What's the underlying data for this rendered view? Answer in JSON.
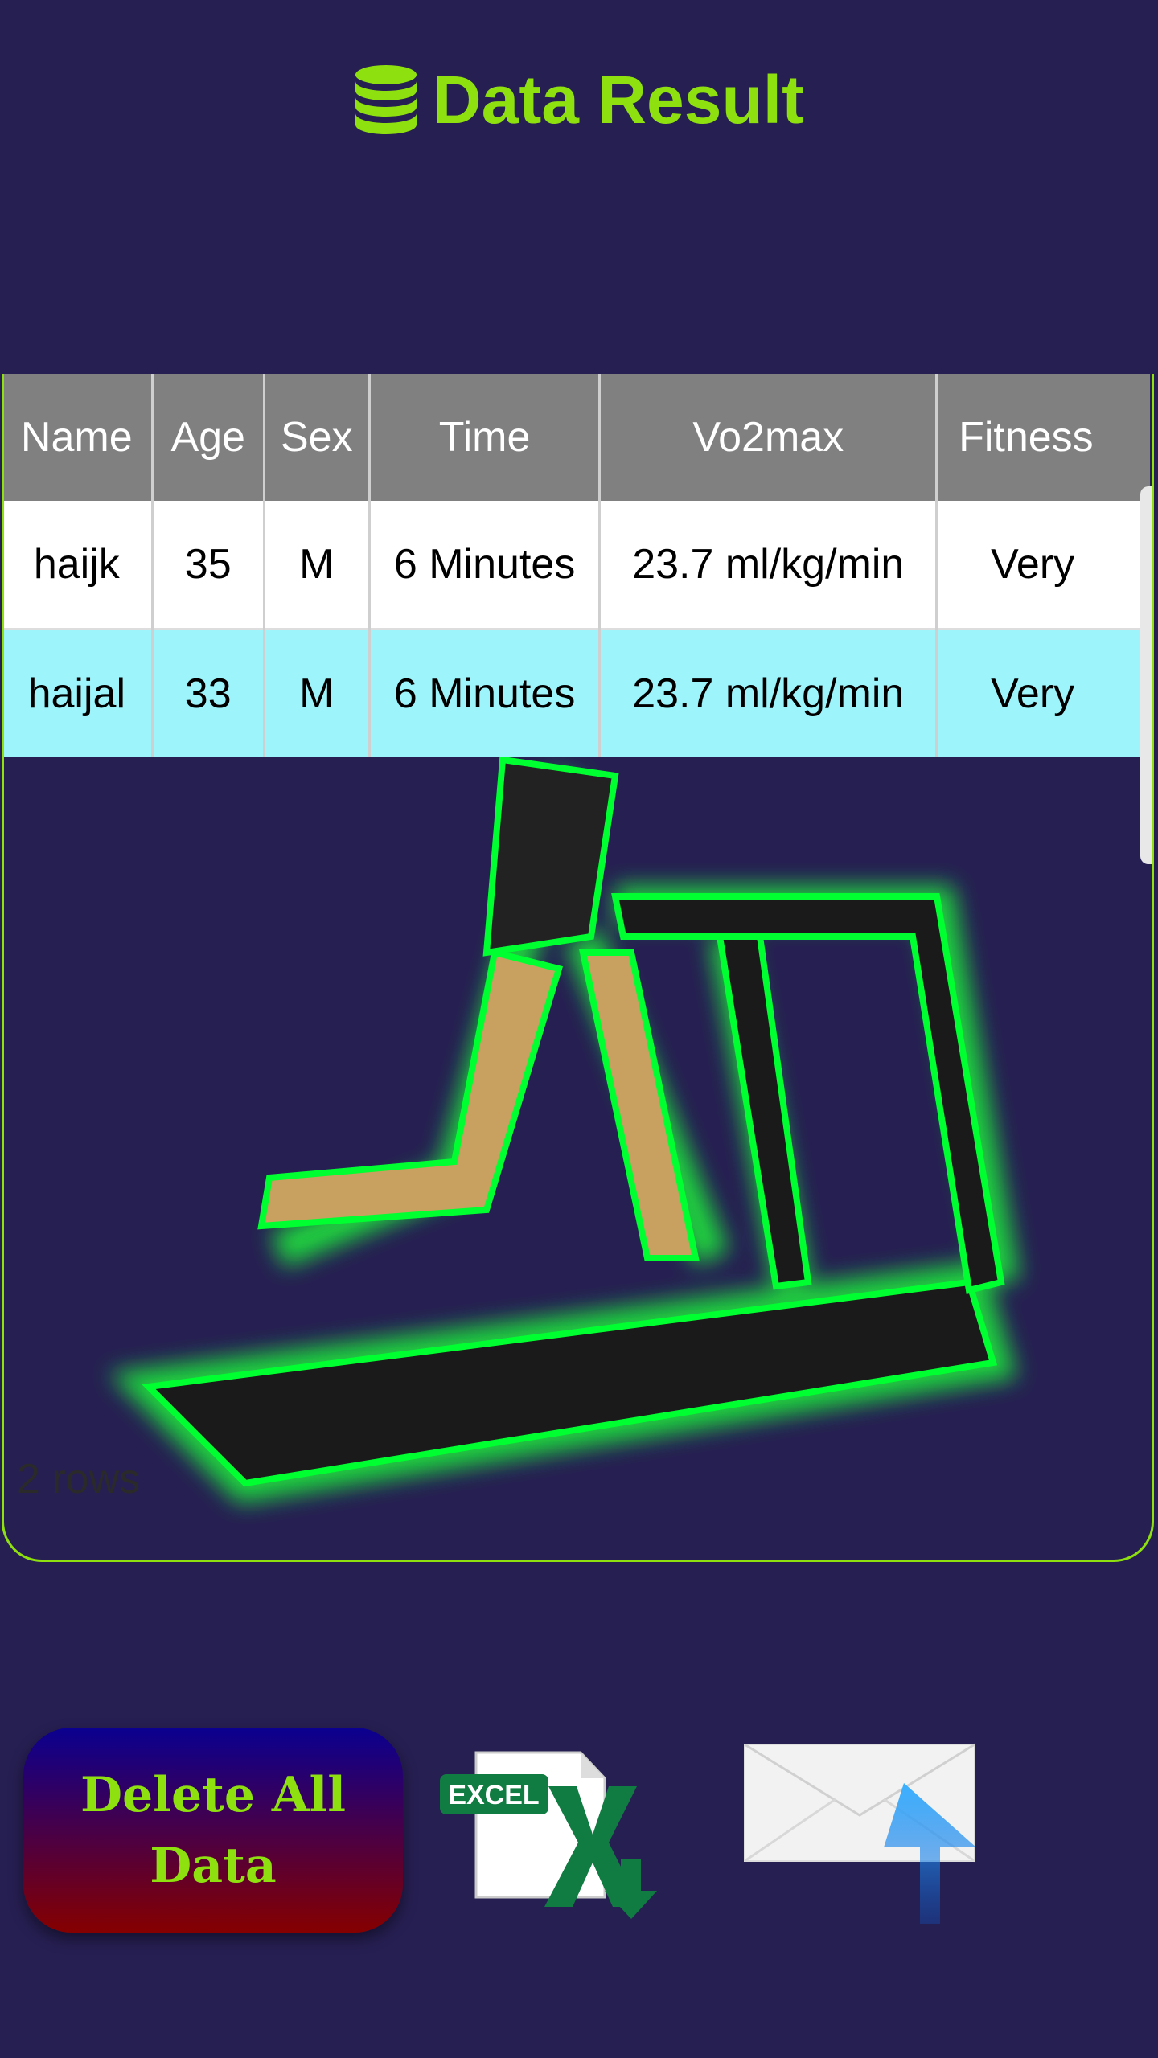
{
  "header": {
    "title": "Data Result",
    "icon": "database-icon"
  },
  "table": {
    "columns": [
      "Name",
      "Age",
      "Sex",
      "Time",
      "Vo2max",
      "Fitness"
    ],
    "rows": [
      [
        "haijk",
        "35",
        "M",
        "6 Minutes",
        "23.7 ml/kg/min",
        "Very"
      ],
      [
        "haijal",
        "33",
        "M",
        "6 Minutes",
        "23.7 ml/kg/min",
        "Very"
      ]
    ],
    "row_count_label": "2 rows"
  },
  "actions": {
    "delete_label_line1": "Delete All",
    "delete_label_line2": "Data",
    "excel_label": "EXCEL",
    "email_icon": "email-upload-icon"
  },
  "colors": {
    "accent": "#8ee10f",
    "background": "#261f52",
    "header_bg": "#808080",
    "alt_row": "#9df5fb"
  }
}
